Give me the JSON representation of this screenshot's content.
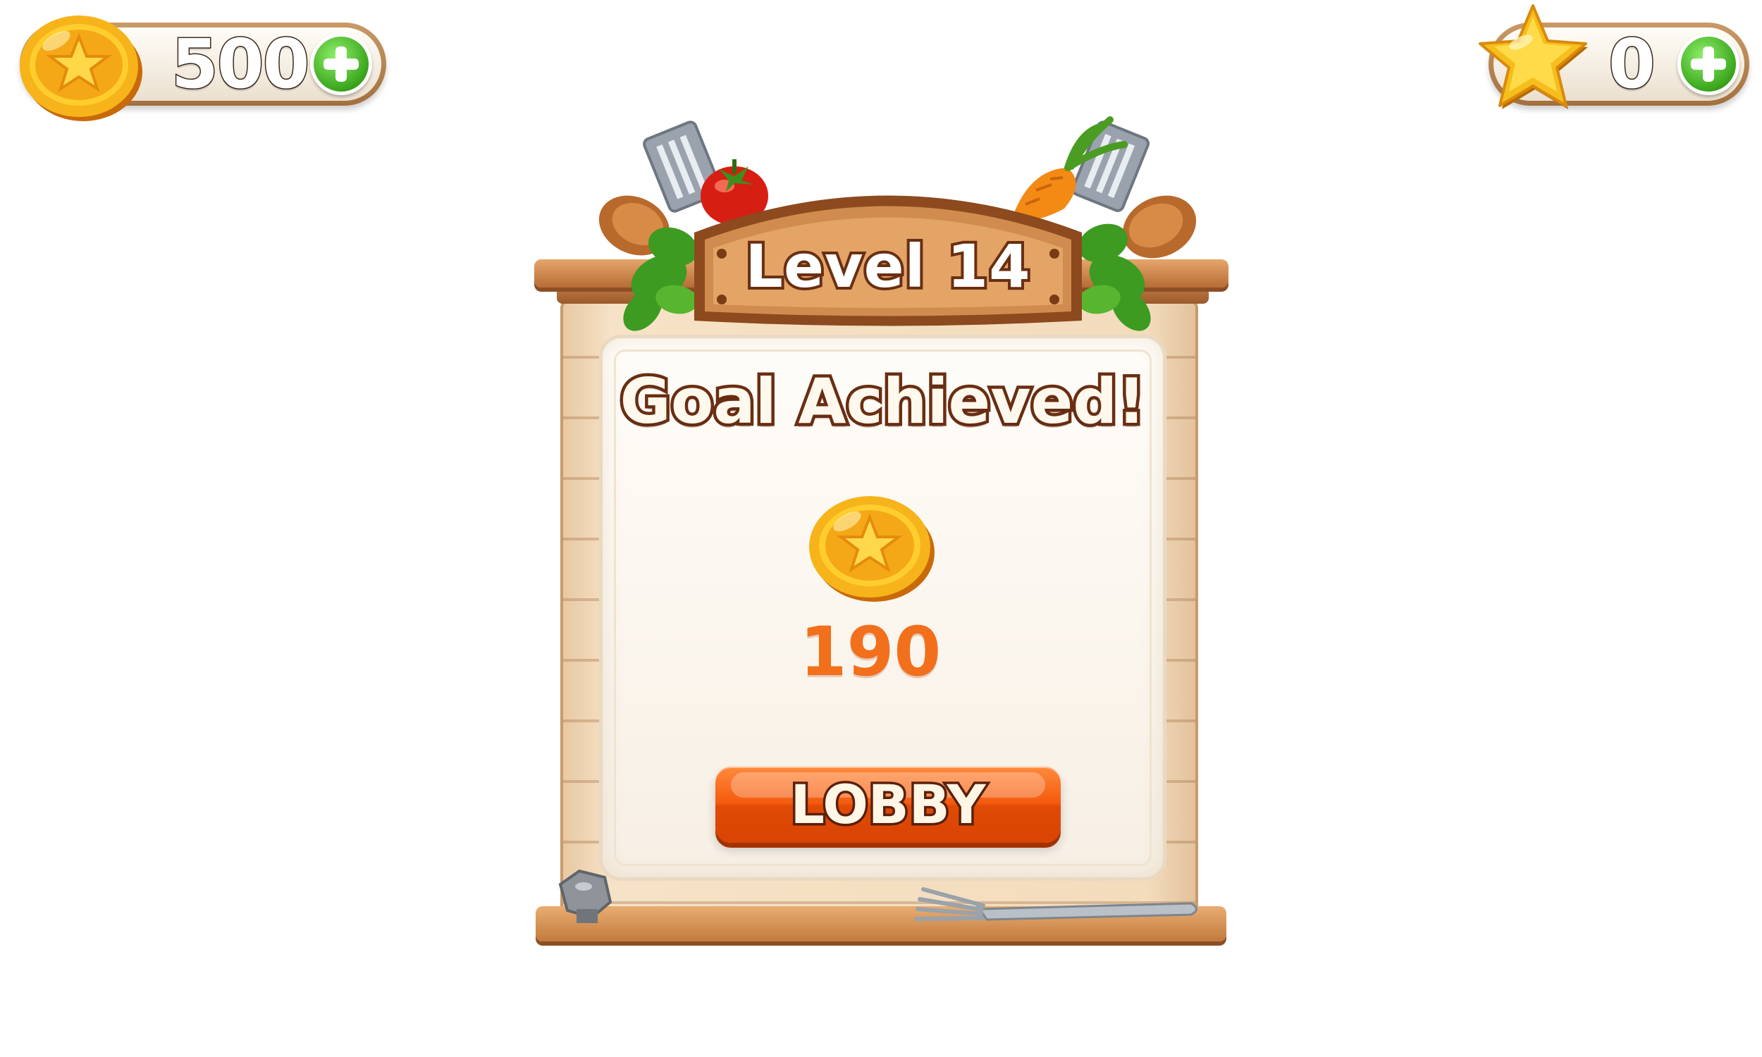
{
  "hud": {
    "coins": {
      "value": "500",
      "icon": "coin-icon",
      "add_icon": "plus-icon"
    },
    "stars": {
      "value": "0",
      "icon": "star-icon",
      "add_icon": "plus-icon"
    }
  },
  "panel": {
    "level_title": "Level 14",
    "heading": "Goal Achieved!",
    "reward": {
      "icon": "coin-icon",
      "amount": "190"
    },
    "lobby_button": "LOBBY"
  },
  "colors": {
    "accent_orange": "#f26f1c",
    "button_orange": "#f45a0e",
    "wood": "#b76c35",
    "text_outline": "#6a2e12",
    "plus_green": "#3aa51c"
  }
}
